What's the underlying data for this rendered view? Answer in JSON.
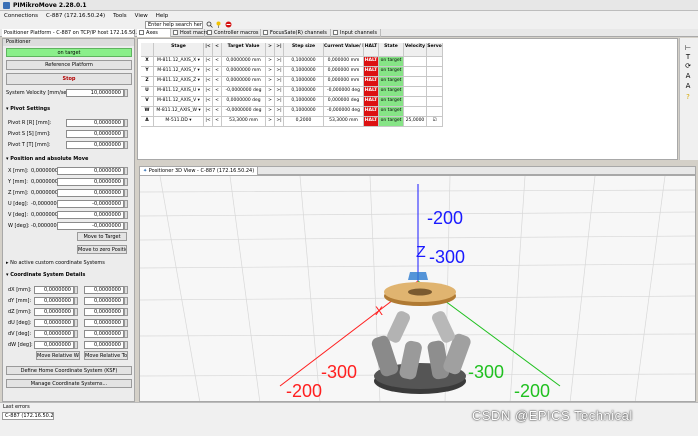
{
  "window": {
    "title": "PIMikroMove 2.28.0.1"
  },
  "menu": [
    "Connections",
    "C-887 (172.16.50.24)",
    "Tools",
    "View",
    "Help"
  ],
  "toolbar": {
    "search_placeholder": "Enter help search here"
  },
  "tabs": [
    {
      "label": "Positioner Platform - C-887 on TCP/IP host 172.16.50.24:...",
      "active": true
    },
    {
      "label": "Axes",
      "active": true
    },
    {
      "label": "Host macros",
      "active": false
    },
    {
      "label": "Controller macros",
      "active": false
    },
    {
      "label": "FocusSate(R) channels",
      "active": false
    },
    {
      "label": "Input channels",
      "active": false
    }
  ],
  "left_panel": {
    "title": "Positioner",
    "on_target": "on target",
    "reference_platform": "Reference Platform",
    "stop": "Stop",
    "system_velocity_label": "System Velocity [mm/sec]:",
    "system_velocity_value": "10,0000000",
    "pivot_settings": "Pivot Settings",
    "pivot_rows": [
      {
        "label": "Pivot R [R] [mm]:",
        "value": "0,0000000"
      },
      {
        "label": "Pivot S [S] [mm]:",
        "value": "0,0000000"
      },
      {
        "label": "Pivot T [T] [mm]:",
        "value": "0,0000000"
      }
    ],
    "position_move": "Position and absolute Move",
    "pos_rows": [
      {
        "label": "X [mm]:",
        "cur": "0,0000000",
        "target": "0,0000000"
      },
      {
        "label": "Y [mm]:",
        "cur": "0,0000000",
        "target": "0,0000000"
      },
      {
        "label": "Z [mm]:",
        "cur": "0,0000000",
        "target": "0,0000000"
      },
      {
        "label": "U [deg]:",
        "cur": "-0,0000000",
        "target": "-0,0000000"
      },
      {
        "label": "V [deg]:",
        "cur": "0,0000000",
        "target": "0,0000000"
      },
      {
        "label": "W [deg]:",
        "cur": "-0,0000000",
        "target": "-0,0000000"
      }
    ],
    "move_to_target": "Move to Target",
    "move_to_zero": "Move to zero Position",
    "no_active": "No active custom coordinate Systems",
    "coord_details": "Coordinate System Details",
    "coord_rows": [
      {
        "label": "dX [mm]:",
        "a": "0,0000000",
        "b": "0,0000000"
      },
      {
        "label": "dY [mm]:",
        "a": "0,0000000",
        "b": "0,0000000"
      },
      {
        "label": "dZ [mm]:",
        "a": "0,0000000",
        "b": "0,0000000"
      },
      {
        "label": "dU [deg]:",
        "a": "0,0000000",
        "b": "0,0000000"
      },
      {
        "label": "dV [deg]:",
        "a": "0,0000000",
        "b": "0,0000000"
      },
      {
        "label": "dW [deg]:",
        "a": "0,0000000",
        "b": "0,0000000"
      }
    ],
    "move_relative_work": "Move Relative Work",
    "move_relative_tool": "Move Relative Tool",
    "define_home": "Define Home Coordinate System (KSF)",
    "manage_coord": "Manage Coordinate Systems..."
  },
  "axes_table": {
    "headers": [
      "",
      "Stage",
      "|<",
      "<",
      "Target Value",
      ">",
      ">|",
      "Step size",
      "Current Value/ Position",
      "HALT",
      "State",
      "Velocity",
      "Servo"
    ],
    "rows": [
      {
        "axis": "X",
        "stage": "M-811.12_AXIS_X",
        "target": "0,0000000",
        "unit": "mm",
        "step": "0,1000000",
        "cur": "0,000000",
        "cunit": "mm",
        "state": "on target",
        "velocity": "",
        "servo": false
      },
      {
        "axis": "Y",
        "stage": "M-811.12_AXIS_Y",
        "target": "0,0000000",
        "unit": "mm",
        "step": "0,1000000",
        "cur": "0,000000",
        "cunit": "mm",
        "state": "on target",
        "velocity": "",
        "servo": false
      },
      {
        "axis": "Z",
        "stage": "M-811.12_AXIS_Z",
        "target": "0,0000000",
        "unit": "mm",
        "step": "0,1000000",
        "cur": "0,000000",
        "cunit": "mm",
        "state": "on target",
        "velocity": "",
        "servo": false
      },
      {
        "axis": "U",
        "stage": "M-811.12_AXIS_U",
        "target": "-0,0000000",
        "unit": "deg",
        "step": "0,1000000",
        "cur": "-0,000000",
        "cunit": "deg",
        "state": "on target",
        "velocity": "",
        "servo": false
      },
      {
        "axis": "V",
        "stage": "M-811.12_AXIS_V",
        "target": "0,0000000",
        "unit": "deg",
        "step": "0,1000000",
        "cur": "0,000000",
        "cunit": "deg",
        "state": "on target",
        "velocity": "",
        "servo": false
      },
      {
        "axis": "W",
        "stage": "M-811.12_AXIS_W",
        "target": "-0,0000000",
        "unit": "deg",
        "step": "0,1000000",
        "cur": "-0,000000",
        "cunit": "deg",
        "state": "on target",
        "velocity": "",
        "servo": false
      },
      {
        "axis": "A",
        "stage": "M-511.DD",
        "target": "53,3000",
        "unit": "mm",
        "step": "0,2000",
        "cur": "53,3000",
        "cunit": "mm",
        "state": "on target",
        "velocity": "25,0000",
        "servo": true
      }
    ],
    "halt_label": "HALT"
  },
  "view3d": {
    "tab_label": "Positioner 3D View - C-887 (172.16.50.24)",
    "labels": {
      "z_axis": "Z",
      "x_axis": "X",
      "z_neg200": "-200",
      "z_neg300": "-300",
      "x_neg200": "-200",
      "x_neg300": "-300",
      "y_neg300": "-300",
      "y_neg200": "-200"
    }
  },
  "status": {
    "last_errors": "Last errors",
    "controller": "C-887 (172.16.50.24)"
  },
  "watermark": "CSDN @EPICS Technical",
  "colors": {
    "on_target": "#86e486",
    "halt": "#dd1111",
    "x_axis": "#e01010",
    "y_axis": "#10c010",
    "z_axis": "#1010e0"
  }
}
